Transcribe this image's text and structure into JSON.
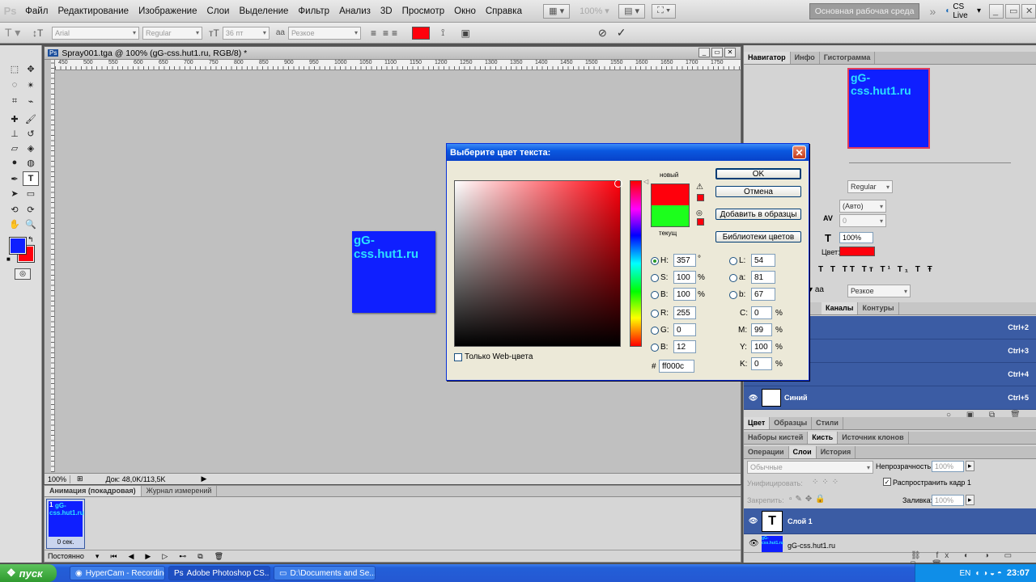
{
  "app": {
    "logo": "Ps"
  },
  "menu": [
    "Файл",
    "Редактирование",
    "Изображение",
    "Слои",
    "Выделение",
    "Фильтр",
    "Анализ",
    "3D",
    "Просмотр",
    "Окно",
    "Справка"
  ],
  "menubar": {
    "zoom": "100%",
    "workspace": "Основная рабочая среда",
    "cslive": "CS Live"
  },
  "options": {
    "font_family": "Arial",
    "font_style": "Regular",
    "font_size": "36 пт",
    "aa_label": "a",
    "aa_value": "Резкое",
    "color": "#ff000c"
  },
  "document": {
    "title": "Spray001.tga @ 100% (gG-css.hut1.ru, RGB/8) *",
    "art_text": "gG-css.hut1.ru",
    "zoom": "100%",
    "doc_info": "Док: 48,0K/113,5K"
  },
  "ruler": [
    "450",
    "500",
    "550",
    "600",
    "650",
    "700",
    "750",
    "800",
    "850",
    "900",
    "950",
    "1000",
    "1050",
    "1100",
    "1150",
    "1200",
    "1250",
    "1300",
    "1350",
    "1400",
    "1450",
    "1500",
    "1550",
    "1600",
    "1650",
    "1700",
    "1750"
  ],
  "animation": {
    "tabs": [
      "Анимация (покадровая)",
      "Журнал измерений"
    ],
    "frame_number": "1",
    "frame_text": "gG-css.hut1.ru",
    "frame_time": "0 сек.",
    "loop": "Постоянно"
  },
  "dialog": {
    "title": "Выберите цвет текста:",
    "new_label": "новый",
    "current_label": "текущ",
    "new_color": "#ff000c",
    "current_color": "#1cff1c",
    "buttons": {
      "ok": "OK",
      "cancel": "Отмена",
      "add_swatches": "Добавить в образцы",
      "libraries": "Библиотеки цветов"
    },
    "fields": {
      "h": {
        "label": "H:",
        "value": "357",
        "unit": "°"
      },
      "s": {
        "label": "S:",
        "value": "100",
        "unit": "%"
      },
      "b": {
        "label": "B:",
        "value": "100",
        "unit": "%"
      },
      "r": {
        "label": "R:",
        "value": "255"
      },
      "g": {
        "label": "G:",
        "value": "0"
      },
      "bb": {
        "label": "B:",
        "value": "12"
      },
      "l": {
        "label": "L:",
        "value": "54"
      },
      "a": {
        "label": "a:",
        "value": "81"
      },
      "lb": {
        "label": "b:",
        "value": "67"
      },
      "c": {
        "label": "C:",
        "value": "0",
        "unit": "%"
      },
      "m": {
        "label": "M:",
        "value": "99",
        "unit": "%"
      },
      "y": {
        "label": "Y:",
        "value": "100",
        "unit": "%"
      },
      "k": {
        "label": "K:",
        "value": "0",
        "unit": "%"
      },
      "hex": {
        "label": "#",
        "value": "ff000c"
      }
    },
    "web_only": "Только Web-цвета"
  },
  "panels": {
    "nav_tabs": [
      "Навигатор",
      "Инфо",
      "Гистограмма"
    ],
    "nav_text": "gG-css.hut1.ru",
    "char": {
      "style": "Regular",
      "leading": "(Авто)",
      "tracking": "0",
      "scale": "100%",
      "color_label": "Цвет:",
      "aa_label": "a",
      "aa_value": "Резкое"
    },
    "channel_tabs": [
      "Каналы",
      "Контуры"
    ],
    "channels": [
      {
        "name": "",
        "shortcut": "Ctrl+2"
      },
      {
        "name": "",
        "shortcut": "Ctrl+3"
      },
      {
        "name": "",
        "shortcut": "Ctrl+4"
      },
      {
        "name": "Синий",
        "shortcut": "Ctrl+5"
      }
    ],
    "color_tabs": [
      "Цвет",
      "Образцы",
      "Стили"
    ],
    "brush_tabs": [
      "Наборы кистей",
      "Кисть",
      "Источник клонов"
    ],
    "layer_tabs": [
      "Операции",
      "Слои",
      "История"
    ],
    "layers": {
      "blend_mode": "Обычные",
      "opacity_label": "Непрозрачность:",
      "opacity": "100%",
      "unify_label": "Унифицировать:",
      "propagate_label": "Распространить кадр 1",
      "lock_label": "Закрепить:",
      "fill_label": "Заливка:",
      "fill": "100%",
      "items": [
        {
          "name": "Слой 1",
          "thumb": "T"
        },
        {
          "name": "gG-css.hut1.ru"
        }
      ]
    }
  },
  "taskbar": {
    "start": "пуск",
    "tasks": [
      "HyperCam - Recording",
      "Adobe Photoshop CS...",
      "D:\\Documents and Se..."
    ],
    "lang": "EN",
    "clock": "23:07"
  }
}
